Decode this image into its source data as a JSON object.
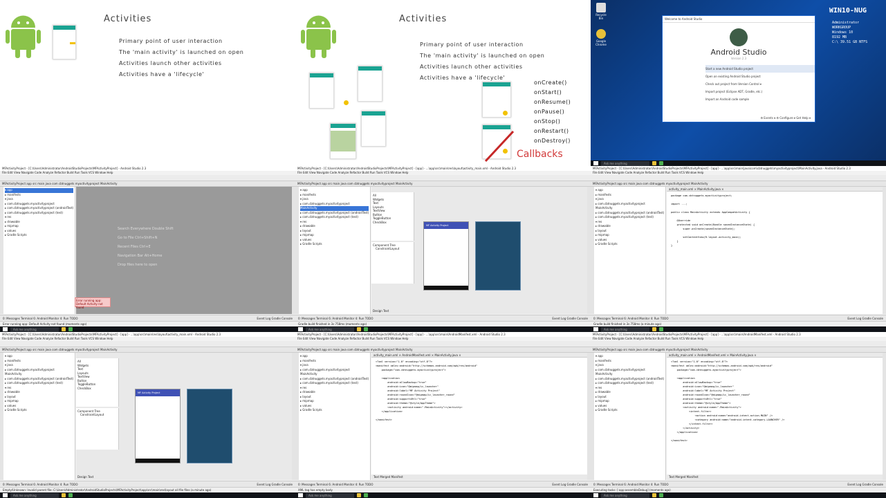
{
  "slide1": {
    "title": "Activities",
    "bullets": [
      "Primary point of user interaction",
      "The 'main activity' is launched on open",
      "Activities launch other activities",
      "Activities have a 'lifecycle'"
    ]
  },
  "slide2": {
    "title": "Activities",
    "bullets": [
      "Primary point of user interaction",
      "The 'main activity' is launched on open",
      "Activities launch other activities",
      "Activities have a 'lifecycle'"
    ],
    "callbacks": [
      "onCreate()",
      "onStart()",
      "onResume()",
      "onPause()",
      "onStop()",
      "onRestart()",
      "onDestroy()"
    ],
    "callbacks_label": "Callbacks"
  },
  "desktop": {
    "hostname": "WIN10-NUG",
    "sysinfo": [
      "Administrator",
      "WORKGROUP",
      "",
      "Windows 10",
      "8192 MB",
      "C:\\ 39.51 GB NTFS"
    ],
    "icons": [
      "Recycle Bin",
      "Google Chrome"
    ],
    "dialog_title": "Welcome to Android Studio",
    "app_name": "Android Studio",
    "version": "Version 2.3",
    "options": [
      "Start a new Android Studio project",
      "Open an existing Android Studio project",
      "Check out project from Version Control ▾",
      "Import project (Eclipse ADT, Gradle, etc.)",
      "Import an Android code sample"
    ],
    "footer": "⚙ Events ▾   ⚙ Configure ▾   Get Help ▾"
  },
  "taskbar": {
    "search": "Ask me anything"
  },
  "ide": {
    "title3": "MFActivityProject - [C:\\Users\\Administrator\\AndroidStudioProjects\\MFActivityProject] - Android Studio 2.3",
    "title4": "MFActivityProject - [C:\\Users\\Administrator\\AndroidStudioProjects\\MFActivityProject] - [app] - ...\\app\\src\\main\\res\\layout\\activity_main.xml - Android Studio 2.3",
    "title5": "MFActivityProject - [C:\\Users\\Administrator\\AndroidStudioProjects\\MFActivityProject] - [app] - ...\\app\\src\\main\\java\\com\\cbtnuggets\\myactivityproject\\MainActivity.java - Android Studio 2.3",
    "title7": "MFActivityProject - [C:\\Users\\Administrator\\AndroidStudioProjects\\MFActivityProject] - [app] - ...\\app\\src\\main\\AndroidManifest.xml - Android Studio 2.3",
    "menu": "File  Edit  View  Navigate  Code  Analyze  Refactor  Build  Run  Tools  VCS  Window  Help",
    "crumb": "MFActivityProject  app  src  main  java  com  cbtnuggets  myactivityproject  MainActivity",
    "tree": [
      "▾ app",
      "  ▸ manifests",
      "  ▾ java",
      "    ▸ com.cbtnuggets.myactivityproject",
      "      MainActivity",
      "    ▸ com.cbtnuggets.myactivityproject (androidTest)",
      "    ▸ com.cbtnuggets.myactivityproject (test)",
      "  ▾ res",
      "    ▸ drawable",
      "    ▸ layout",
      "    ▸ mipmap",
      "    ▸ values",
      "▸ Gradle Scripts"
    ],
    "hints": [
      "Search Everywhere Double Shift",
      "Go to File Ctrl+Shift+N",
      "Recent Files Ctrl+E",
      "Navigation Bar Alt+Home",
      "Drop files here to open"
    ],
    "error_popup": "Error running app: Default Activity not found",
    "bottom_tabs": "0: Messages   Terminal   6: Android Monitor   4: Run   TODO",
    "event_log": "Event Log   Gradle Console",
    "status3": "Error running app: Default Activity not found (moments ago)",
    "status4": "Gradle build finished in 3s 758ms (moments ago)",
    "status5": "Gradle build finished in 3s 758ms (a minute ago)",
    "status6": "Empty/Unknown: Invalid parent file: C:\\Users\\Administrator\\AndroidStudioProjects\\MFActivityProject\\app\\src\\main\\res\\layout all file files (a minute ago)",
    "status7": "XML tag has empty body",
    "status8": "Executing tasks: [:app:assembleDebug] (moments ago)",
    "palette": [
      "All",
      "Widgets",
      "Text",
      "Layouts",
      "TextView",
      "Button",
      "ToggleButton",
      "CheckBox"
    ],
    "component_tree": "Component Tree",
    "constraint": "ConstraintLayout",
    "mock_title": "MF Activity Project",
    "java_code": "package com.cbtnuggets.myactivityproject;\n\nimport ...;\n\npublic class MainActivity extends AppCompatActivity {\n\n    @Override\n    protected void onCreate(Bundle savedInstanceState) {\n        super.onCreate(savedInstanceState);\n\n        setContentView(R.layout.activity_main);\n    }\n}",
    "manifest_code": "<?xml version=\"1.0\" encoding=\"utf-8\"?>\n<manifest xmlns:android=\"http://schemas.android.com/apk/res/android\"\n    package=\"com.cbtnuggets.myactivityproject\">\n\n    <application\n        android:allowBackup=\"true\"\n        android:icon=\"@mipmap/ic_launcher\"\n        android:label=\"MF Activity Project\"\n        android:roundIcon=\"@mipmap/ic_launcher_round\"\n        android:supportsRtl=\"true\"\n        android:theme=\"@style/AppTheme\">\n        <activity android:name=\".MainActivity\"></activity>\n    </application>\n\n</manifest>",
    "manifest_code2": "<?xml version=\"1.0\" encoding=\"utf-8\"?>\n<manifest xmlns:android=\"http://schemas.android.com/apk/res/android\"\n    package=\"com.cbtnuggets.myactivityproject\">\n\n    <application\n        android:allowBackup=\"true\"\n        android:icon=\"@mipmap/ic_launcher\"\n        android:label=\"MF Activity Project\"\n        android:roundIcon=\"@mipmap/ic_launcher_round\"\n        android:supportsRtl=\"true\"\n        android:theme=\"@style/AppTheme\">\n        <activity android:name=\".MainActivity\">\n            <intent-filter>\n                <action android:name=\"android.intent.action.MAIN\" />\n                <category android:name=\"android.intent.category.LAUNCHER\" />\n            </intent-filter>\n        </activity>\n    </application>\n\n</manifest>",
    "editor_tabs_java": "activity_main.xml ×   MainActivity.java ×",
    "editor_tabs_manifest": "activity_main.xml ×   AndroidManifest.xml ×   MainActivity.java ×",
    "design_tabs": "Design   Text",
    "text_tabs": "Text   Merged Manifest"
  }
}
